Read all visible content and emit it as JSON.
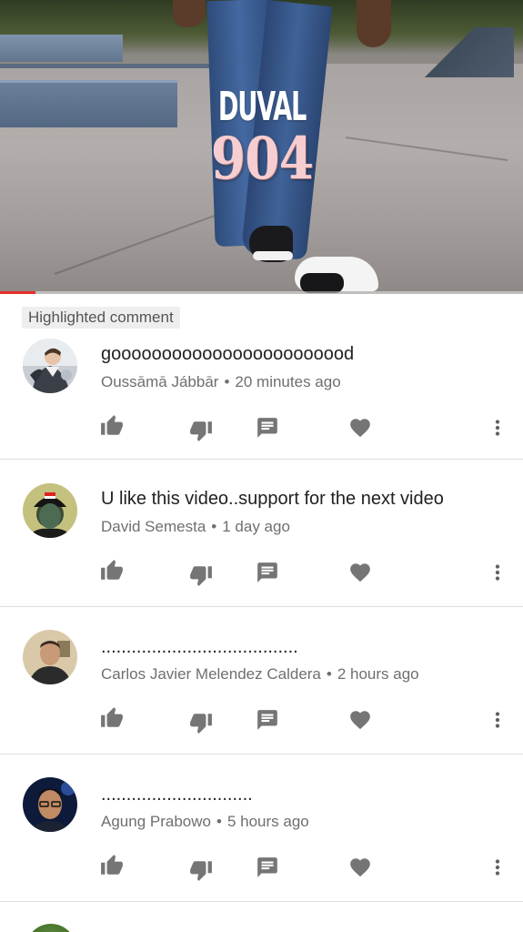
{
  "video": {
    "overlay_title_top": "DUVAL",
    "overlay_title_number": "904",
    "progress": 0.067,
    "progress_color": "#e52d27"
  },
  "highlight_label": "Highlighted comment",
  "comments": [
    {
      "text": "goooooooooooooooooooooood",
      "author": "Oussāmā Jábbār",
      "separator": "•",
      "time": "20 minutes ago",
      "avatar": "avatar-photo-man-light"
    },
    {
      "text": "U like this video..support for the next video",
      "author": "David Semesta",
      "separator": "•",
      "time": "1 day ago",
      "avatar": "avatar-photo-man-cap"
    },
    {
      "text": ".......................................",
      "author": "Carlos Javier Melendez Caldera",
      "separator": "•",
      "time": "2 hours ago",
      "avatar": "avatar-photo-man-selfie"
    },
    {
      "text": "..............................",
      "author": "Agung Prabowo",
      "separator": "•",
      "time": "5 hours ago",
      "avatar": "avatar-photo-man-glasses"
    }
  ],
  "icons": {
    "like": "thumb-up-icon",
    "dislike": "thumb-down-icon",
    "reply": "reply-comment-icon",
    "heart": "heart-icon",
    "more": "more-vertical-icon"
  },
  "colors": {
    "icon_gray": "#757575",
    "meta_gray": "#6f6f6f",
    "divider": "#dedede"
  }
}
